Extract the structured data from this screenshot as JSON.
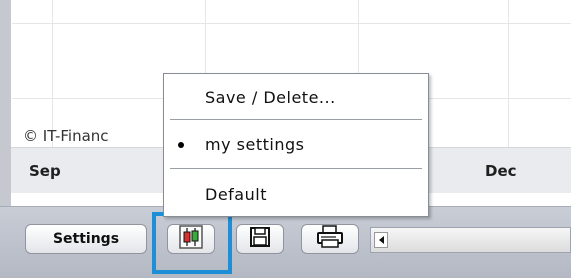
{
  "chart": {
    "copyright": "© IT-Financ",
    "axis_labels": [
      "Sep",
      "Dec"
    ]
  },
  "toolbar": {
    "settings_label": "Settings"
  },
  "menu": {
    "items": [
      {
        "label": "Save / Delete..."
      },
      {
        "label": "my settings",
        "selected": true
      },
      {
        "label": "Default"
      }
    ]
  },
  "icons": {
    "candle": "candlestick-chart-icon",
    "save": "floppy-disk-icon",
    "print": "printer-icon",
    "scroll_left": "scroll-left-arrow-icon"
  },
  "colors": {
    "focus": "#1e8fd6",
    "candle_green": "#3caa3c",
    "candle_red": "#d63030"
  }
}
